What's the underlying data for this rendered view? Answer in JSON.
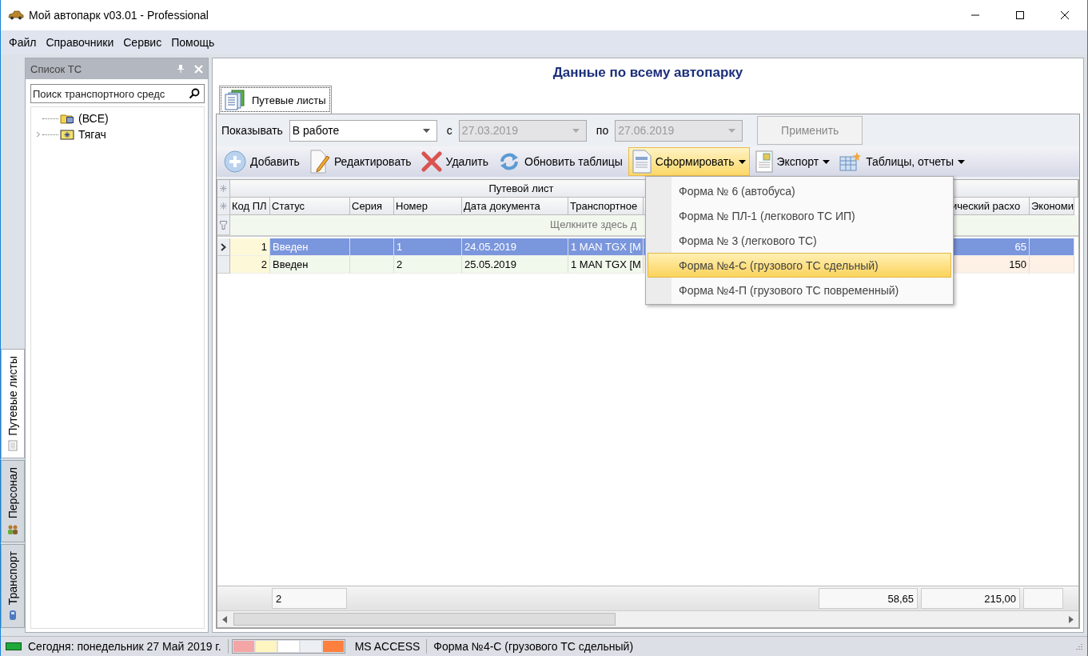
{
  "window": {
    "title": "Мой автопарк v03.01 - Professional"
  },
  "menu": [
    "Файл",
    "Справочники",
    "Сервис",
    "Помощь"
  ],
  "side_tabs": [
    {
      "label": "Путевые листы",
      "selected": true,
      "kind": "sheet"
    },
    {
      "label": "Персонал",
      "selected": false,
      "kind": "people"
    },
    {
      "label": "Транспорт",
      "selected": false,
      "kind": "car"
    }
  ],
  "vehicle_panel": {
    "title": "Список ТС",
    "search": {
      "placeholder": "Поиск транспортного средс"
    },
    "tree": [
      {
        "label": "(ВСЕ)",
        "kind": "all",
        "expandable": false
      },
      {
        "label": "Тягач",
        "kind": "group",
        "expandable": true
      }
    ]
  },
  "main": {
    "heading": "Данные по всему автопарку",
    "tabs": [
      {
        "label": "Путевые листы",
        "selected": true
      }
    ],
    "filter": {
      "show_label": "Показывать",
      "show_value": "В работе",
      "from_label": "с",
      "from_value": "27.03.2019",
      "to_label": "по",
      "to_value": "27.06.2019",
      "dates_disabled": true,
      "apply": "Применить",
      "apply_disabled": true
    },
    "toolbar": [
      {
        "label": "Добавить",
        "kind": "add",
        "dropdown": false,
        "expanded": false
      },
      {
        "label": "Редактировать",
        "kind": "edit",
        "dropdown": false,
        "expanded": false
      },
      {
        "label": "Удалить",
        "kind": "delete",
        "dropdown": false,
        "expanded": false
      },
      {
        "label": "Обновить таблицы",
        "kind": "refresh",
        "dropdown": false,
        "expanded": false
      },
      {
        "label": "Сформировать",
        "kind": "form",
        "dropdown": true,
        "expanded": true
      },
      {
        "label": "Экспорт",
        "kind": "export",
        "dropdown": true,
        "expanded": false
      },
      {
        "label": "Таблицы, отчеты",
        "kind": "tables",
        "dropdown": true,
        "expanded": false
      }
    ],
    "table": {
      "band": "Путевой лист",
      "columns": [
        "Код ПЛ",
        "Статус",
        "Серия",
        "Номер",
        "Дата документа",
        "Транспортное",
        "ический расхо",
        "Экономи"
      ],
      "filter_hint": "Щелкните здесь д",
      "rows": [
        {
          "code": "1",
          "status": "Введен",
          "number": "1",
          "date": "24.05.2019",
          "vehicle": "1 MAN TGX [M",
          "consumption": "65",
          "selected": true
        },
        {
          "code": "2",
          "status": "Введен",
          "number": "2",
          "date": "25.05.2019",
          "vehicle": "1 MAN TGX [M",
          "consumption": "150",
          "selected": false
        }
      ],
      "footer": {
        "count": "2",
        "sum_1": "58,65",
        "sum_2": "215,00"
      }
    },
    "dropdown_menu": [
      {
        "label": "Форма № 6 (автобуса)",
        "selected": false
      },
      {
        "label": "Форма № ПЛ-1 (легкового ТС ИП)",
        "selected": false
      },
      {
        "label": "Форма № 3 (легкового ТС)",
        "selected": false
      },
      {
        "label": "Форма №4-С (грузового ТС сдельный)",
        "selected": true
      },
      {
        "label": "Форма №4-П (грузового ТС повременный)",
        "selected": false
      }
    ]
  },
  "status_bar": {
    "date": "Сегодня: понедельник 27 Май 2019 г.",
    "legend": [
      {
        "color": "#f4a6a6"
      },
      {
        "color": "#fff5c0"
      },
      {
        "color": "#ffffff"
      },
      {
        "color": "#eceff3"
      },
      {
        "color": "#ff7f3f"
      }
    ],
    "db": "MS ACCESS",
    "message": "Форма №4-С (грузового ТС сдельный)"
  }
}
